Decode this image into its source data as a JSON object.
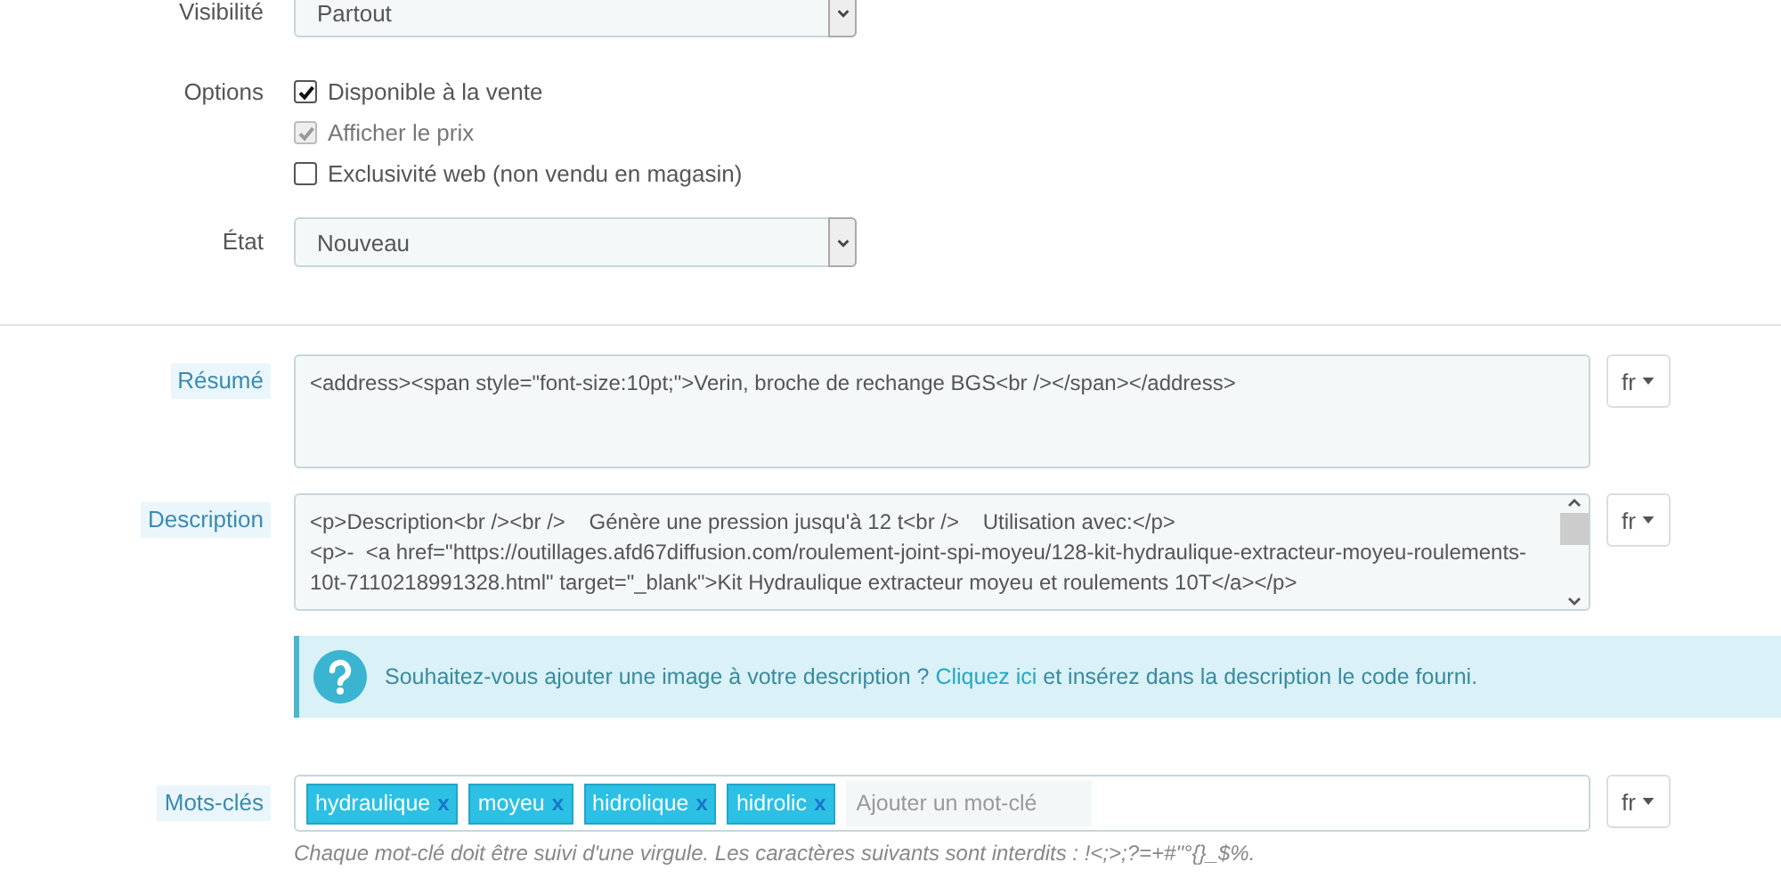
{
  "visibility": {
    "label": "Visibilité",
    "value": "Partout"
  },
  "options": {
    "label": "Options",
    "items": [
      {
        "label": "Disponible à la vente",
        "checked": true,
        "disabled": false
      },
      {
        "label": "Afficher le prix",
        "checked": true,
        "disabled": true
      },
      {
        "label": "Exclusivité web (non vendu en magasin)",
        "checked": false,
        "disabled": false
      }
    ]
  },
  "condition": {
    "label": "État",
    "value": "Nouveau"
  },
  "summary": {
    "label": "Résumé",
    "value": "<address><span style=\"font-size:10pt;\">Verin, broche de rechange BGS<br /></span></address>",
    "language": "fr"
  },
  "description": {
    "label": "Description",
    "value": "<p>Description<br /><br />    Génère une pression jusqu'à 12 t<br />    Utilisation avec:</p>\n<p>-  <a href=\"https://outillages.afd67diffusion.com/roulement-joint-spi-moyeu/128-kit-hydraulique-extracteur-moyeu-roulements-10t-7110218991328.html\" target=\"_blank\">Kit Hydraulique extracteur moyeu et roulements 10T</a></p>",
    "language": "fr"
  },
  "alert": {
    "text_before": "Souhaitez-vous ajouter une image à votre description ? ",
    "link": "Cliquez ici",
    "text_after": " et insérez dans la description le code fourni."
  },
  "keywords": {
    "label": "Mots-clés",
    "tags": [
      {
        "label": "hydraulique",
        "remove": "x"
      },
      {
        "label": "moyeu",
        "remove": "x"
      },
      {
        "label": "hidrolique",
        "remove": "x"
      },
      {
        "label": "hidrolic",
        "remove": "x"
      }
    ],
    "placeholder": "Ajouter un mot-clé",
    "language": "fr",
    "help": "Chaque mot-clé doit être suivi d'une virgule. Les caractères suivants sont interdits : !<;>;?=+#\"°{}_$%."
  }
}
